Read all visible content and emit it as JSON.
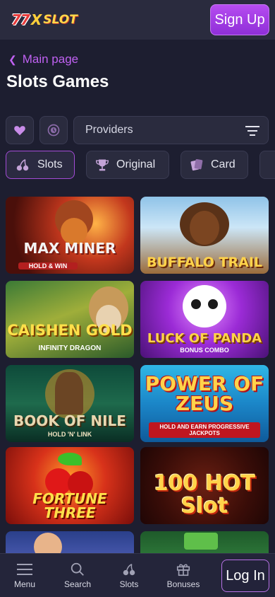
{
  "header": {
    "logo": {
      "part1": "77",
      "part2": "X",
      "part3": "SLOT"
    },
    "signup_label": "Sign Up"
  },
  "breadcrumb": {
    "back_label": "Main page"
  },
  "page_title": "Slots Games",
  "filters": {
    "favorites_icon": "heart-icon",
    "recent_icon": "clock-icon",
    "providers_label": "Providers",
    "filter_icon": "filter-lines-icon"
  },
  "tabs": [
    {
      "label": "Slots",
      "icon": "cherry-icon",
      "active": true
    },
    {
      "label": "Original",
      "icon": "trophy-icon",
      "active": false
    },
    {
      "label": "Card",
      "icon": "card-icon",
      "active": false
    }
  ],
  "games": [
    {
      "title": "MAX MINER",
      "subtitle": "HOLD & WIN"
    },
    {
      "title": "BUFFALO TRAIL",
      "subtitle": ""
    },
    {
      "title": "CAISHEN GOLD",
      "subtitle": "INFINITY DRAGON"
    },
    {
      "title": "LUCK OF PANDA",
      "subtitle": "BONUS COMBO"
    },
    {
      "title": "BOOK OF NILE",
      "subtitle": "HOLD 'N' LINK"
    },
    {
      "title": "POWER OF ZEUS",
      "subtitle": "HOLD AND EARN PROGRESSIVE JACKPOTS"
    },
    {
      "title": "FORTUNE THREE",
      "subtitle": ""
    },
    {
      "title": "100 HOT Slot",
      "subtitle": ""
    }
  ],
  "nav": {
    "menu": "Menu",
    "search": "Search",
    "slots": "Slots",
    "bonuses": "Bonuses",
    "login": "Log In"
  },
  "colors": {
    "accent": "#a34bd6",
    "background": "#1d1e30",
    "panel": "#2a2b3e"
  }
}
